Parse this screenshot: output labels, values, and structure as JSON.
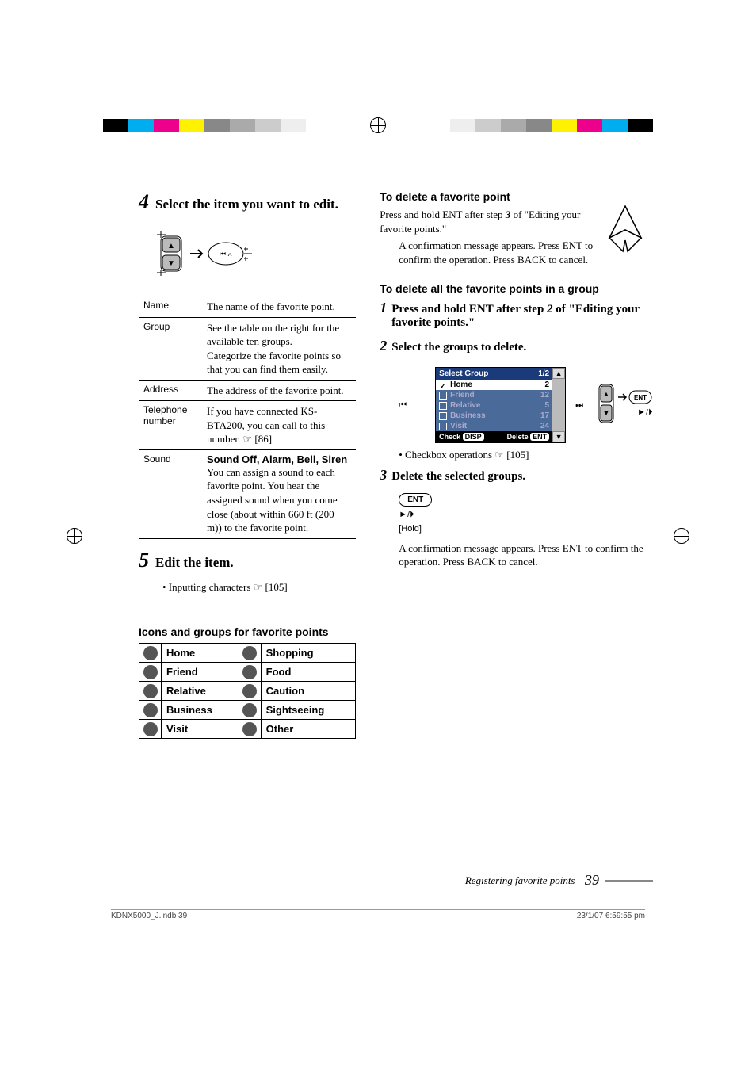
{
  "left": {
    "step4": {
      "num": "4",
      "text": "Select the item you want to edit."
    },
    "defs": [
      {
        "term": "Name",
        "desc": "The name of the favorite point."
      },
      {
        "term": "Group",
        "desc": "See the table on the right for the available ten groups.\nCategorize the favorite points so that you can find them easily."
      },
      {
        "term": "Address",
        "desc": "The address of the favorite point."
      },
      {
        "term": "Telephone number",
        "desc": "If you have connected KS-BTA200, you can call to this number. ☞ [86]"
      },
      {
        "term": "Sound",
        "bold": "Sound Off, Alarm, Bell, Siren",
        "desc": "You can assign a sound to each favorite point. You hear the assigned sound when you come close (about within 660 ft (200 m)) to the favorite point."
      }
    ],
    "step5": {
      "num": "5",
      "text": "Edit the item."
    },
    "step5_bullet": "• Inputting characters ☞ [105]",
    "icons_heading": "Icons and groups for favorite points",
    "icon_rows": [
      [
        "Home",
        "Shopping"
      ],
      [
        "Friend",
        "Food"
      ],
      [
        "Relative",
        "Caution"
      ],
      [
        "Business",
        "Sightseeing"
      ],
      [
        "Visit",
        "Other"
      ]
    ]
  },
  "right": {
    "del_point_heading": "To delete a favorite point",
    "del_point_body1": "Press and hold ENT after step 3 of \"Editing your favorite points.\"",
    "del_point_body2": "A confirmation message appears. Press ENT to confirm the operation. Press BACK to cancel.",
    "del_group_heading": "To delete all the favorite points in a group",
    "g_step1": {
      "num": "1",
      "text_a": "Press and hold ENT after step ",
      "step_ref": "2",
      "text_b": " of \"Editing your favorite points.\""
    },
    "g_step2": {
      "num": "2",
      "text": "Select the groups to delete."
    },
    "screenshot": {
      "title": "Select Group",
      "page": "1/2",
      "rows": [
        {
          "label": "Home",
          "count": "2",
          "sel": true,
          "checked": true
        },
        {
          "label": "Friend",
          "count": "12",
          "sel": false
        },
        {
          "label": "Relative",
          "count": "5",
          "sel": false
        },
        {
          "label": "Business",
          "count": "17",
          "sel": false
        },
        {
          "label": "Visit",
          "count": "24",
          "sel": false
        }
      ],
      "footer_left": "Check",
      "footer_left_btn": "DISP",
      "footer_right": "Delete",
      "footer_right_btn": "ENT"
    },
    "ent_label": "ENT",
    "checkbox_ops": "• Checkbox operations ☞ [105]",
    "g_step3": {
      "num": "3",
      "text": "Delete the selected groups."
    },
    "hold_ent": "ENT",
    "hold_arrows": "►/⏵",
    "hold_label": "[Hold]",
    "g_step3_body": "A confirmation message appears. Press ENT to confirm the operation. Press BACK to cancel."
  },
  "footer": {
    "section": "Registering favorite points",
    "page": "39"
  },
  "printinfo": {
    "file": "KDNX5000_J.indb   39",
    "date": "23/1/07   6:59:55 pm"
  }
}
